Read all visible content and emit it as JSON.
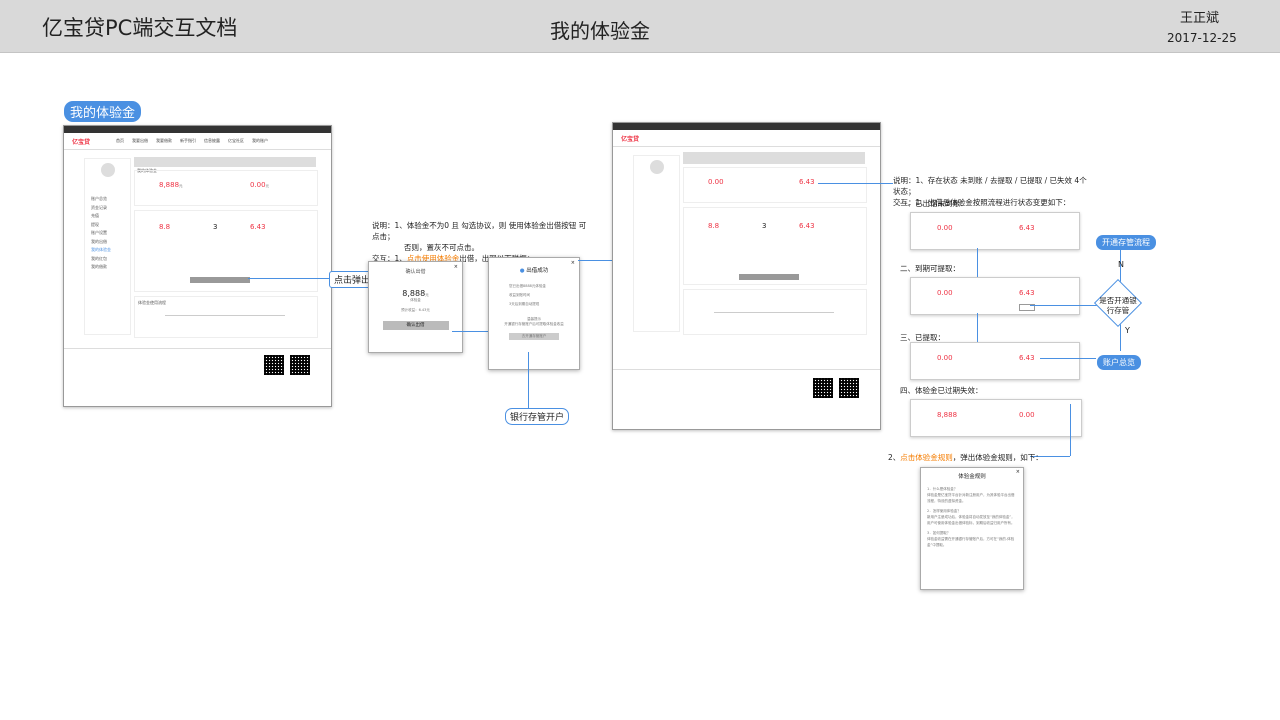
{
  "header": {
    "doc_title": "亿宝贷PC端交互文档",
    "page_title": "我的体验金",
    "author": "王正斌",
    "date": "2017-12-25"
  },
  "section_badge": "我的体验金",
  "screen1": {
    "logo": "亿宝贷",
    "nav": [
      "首页",
      "我要出借",
      "我要借款",
      "新手指引",
      "信息披露",
      "亿宝社区",
      "我的账户"
    ],
    "panel_title": "我的体验金",
    "amount1": "8,888",
    "amount1_unit": "元",
    "amount2": "0.00",
    "amount2_unit": "元",
    "rate": "8.8",
    "days": "3",
    "earn": "6.43",
    "rules_title": "体验金使用流程",
    "sidebar": [
      "账户总览",
      "资金记录",
      "充值",
      "提现",
      "账户设置",
      "我的出借",
      "我的体验金",
      "我的红包",
      "我的借款"
    ]
  },
  "callout_click_popup": "点击弹出",
  "note1": {
    "line1": "说明：1、体验金不为0 且 勾选协议，则 使用体验金出借按钮 可点击；",
    "line2": "否则，置灰不可点击。",
    "line3_prefix": "交互：1、",
    "line3_link": "点击使用体验金",
    "line3_suffix": "出借，出现以下弹框："
  },
  "dialog_confirm": {
    "title": "确认出借",
    "amount": "8,888",
    "amount_unit": "元",
    "sub": "体验金",
    "note": "预计收益：6.43元",
    "button": "确认出借"
  },
  "dialog_success": {
    "title": "出借成功",
    "steps": [
      "您已出借8888元体验金",
      "收益到账时间",
      "3天后到期自动提现"
    ],
    "hint": "温馨提示",
    "msg": "开通银行存管账户后可提取体验金收益",
    "button": "去开通存管账户"
  },
  "callout_bank": "银行存管开户",
  "screen2": {
    "logo": "亿宝贷",
    "amount1": "0.00",
    "amount2": "6.43",
    "rate": "8.8",
    "days": "3",
    "earn": "6.43"
  },
  "note2": {
    "line1": "说明：1、存在状态 未到账 / 去提取 / 已提取 / 已失效 4个状态；",
    "line2": "交互：1、出借后体验金按照流程进行状态变更如下："
  },
  "states": [
    {
      "label": "一、已出借未到账：",
      "v1": "0.00",
      "v2": "6.43"
    },
    {
      "label": "二、到期可提取：",
      "v1": "0.00",
      "v2": "6.43"
    },
    {
      "label": "三、已提取：",
      "v1": "0.00",
      "v2": "6.43"
    },
    {
      "label": "四、体验金已过期失效：",
      "v1": "8,888",
      "v2": "0.00"
    }
  ],
  "flow": {
    "open_custody": "开通存管流程",
    "question": "是否开通银行存管",
    "no": "N",
    "yes": "Y",
    "overview": "账户总览"
  },
  "note3": {
    "prefix": "2、",
    "link": "点击体验金规则",
    "suffix": "，弹出体验金规则，如下："
  },
  "rules_dialog": {
    "title": "体验金规则",
    "q1": "1．什么是体验金？",
    "a1": "体验金是亿宝贷平台针对新注册用户，为其体验平台出借流程，特设的虚拟资金。",
    "q2": "2．怎样使用体验金？",
    "a2": "新用户注册成功后，体验金将自动发放至“我的体验金”，用户可使用体验金出借体验标，到期后收益归用户所有。",
    "q3": "3．如何提取？",
    "a3": "体验金收益需在开通银行存管账户后，方可在“我的-体验金”中提取。"
  },
  "colors": {
    "accent": "#4a90e2",
    "orange": "#f57c00",
    "red": "#e34433",
    "header_bg": "#d9d9d9"
  }
}
